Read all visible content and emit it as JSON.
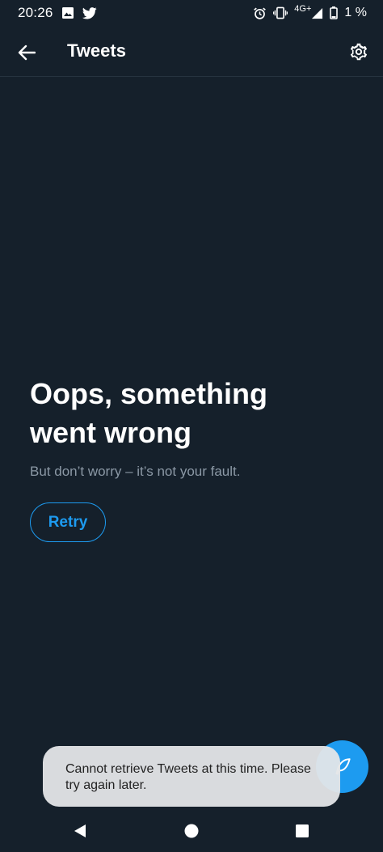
{
  "status_bar": {
    "time": "20:26",
    "left_icons": [
      "image-icon",
      "twitter-bird-icon"
    ],
    "network_label": "4G",
    "network_sup": "+",
    "battery_text": "1 %",
    "right_icons": [
      "alarm-icon",
      "vibrate-icon",
      "signal-icon",
      "battery-icon"
    ]
  },
  "app_bar": {
    "title": "Tweets",
    "back_icon": "arrow-left-icon",
    "settings_icon": "gear-icon"
  },
  "error": {
    "title_line1": "Oops, something",
    "title_line2": "went wrong",
    "subtitle": "But don’t worry – it’s not your fault.",
    "retry_label": "Retry"
  },
  "toast": {
    "message": "Cannot retrieve Tweets at this time. Please try again later."
  },
  "fab": {
    "icon": "feather-compose-icon"
  },
  "nav": {
    "icons": [
      "back-triangle-icon",
      "home-circle-icon",
      "recents-square-icon"
    ]
  },
  "colors": {
    "background": "#15202b",
    "accent": "#1d9bf0",
    "subtitle": "#8b98a5",
    "toast_bg": "#e4e6e8"
  }
}
